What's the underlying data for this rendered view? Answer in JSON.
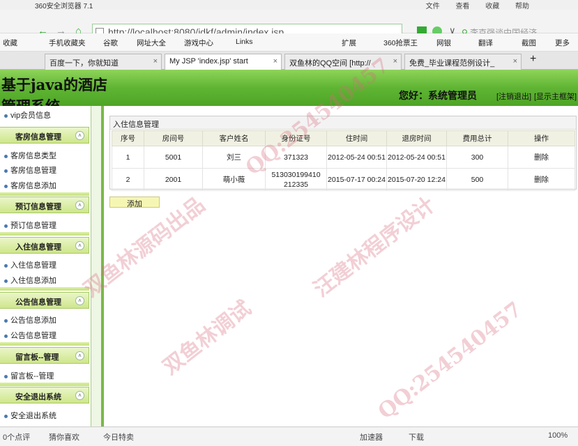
{
  "browser": {
    "window_title": "360安全浏览器 7.1",
    "menu": [
      "文件",
      "查看",
      "收藏",
      "帮助"
    ],
    "address": "http://localhost:8080/jdkf/admin/index.jsp",
    "address_host": "localhost",
    "search_placeholder": "李克强谈中国经济",
    "bookmarks": [
      "收藏",
      "手机收藏夹",
      "谷歌",
      "网址大全",
      "游戏中心",
      "Links",
      "扩展",
      "360抢票王",
      "网银",
      "翻译",
      "截图",
      "更多"
    ],
    "tabs": [
      {
        "label": "百度一下，你就知道"
      },
      {
        "label": "My JSP 'index.jsp' start"
      },
      {
        "label": "双鱼林的QQ空间 [http://"
      },
      {
        "label": "免费_毕业课程范例设计_"
      }
    ],
    "status": [
      "0个点评",
      "猜你喜欢",
      "今日特卖",
      "加速器",
      "下载",
      "100%"
    ]
  },
  "header": {
    "title_line1": "基于java的酒店",
    "title_line2": "管理系统",
    "greeting": "您好：系统管理员",
    "logout": "[注销退出]",
    "show_frame": "[显示主框架]"
  },
  "sidebar": {
    "top_item": "vip会员信息",
    "groups": [
      {
        "title": "客房信息管理",
        "items": [
          "客房信息类型",
          "客房信息管理",
          "客房信息添加"
        ]
      },
      {
        "title": "预订信息管理",
        "items": [
          "预订信息管理"
        ]
      },
      {
        "title": "入住信息管理",
        "items": [
          "入住信息管理",
          "入住信息添加"
        ]
      },
      {
        "title": "公告信息管理",
        "items": [
          "公告信息添加",
          "公告信息管理"
        ]
      },
      {
        "title": "留言板--管理",
        "items": [
          "留言板--管理"
        ]
      },
      {
        "title": "安全退出系统",
        "items": [
          "安全退出系统"
        ]
      }
    ]
  },
  "main": {
    "panel_title": "入住信息管理",
    "columns": [
      "序号",
      "房间号",
      "客户姓名",
      "身份证号",
      "住时间",
      "退房时间",
      "费用总计",
      "操作"
    ],
    "rows": [
      [
        "1",
        "5001",
        "刘三",
        "371323",
        "2012-05-24 00:51",
        "2012-05-24 00:51",
        "300",
        "删除"
      ],
      [
        "2",
        "2001",
        "萌小薇",
        "513030199410212335",
        "2015-07-17 00:24",
        "2015-07-20 12:24",
        "500",
        "删除"
      ]
    ],
    "add_button": "添加"
  },
  "watermark": {
    "texts": [
      "双鱼林调试",
      "QQ:254540457",
      "双鱼林源码出品",
      "汪建林程序设计"
    ],
    "color": "#d7697d"
  }
}
